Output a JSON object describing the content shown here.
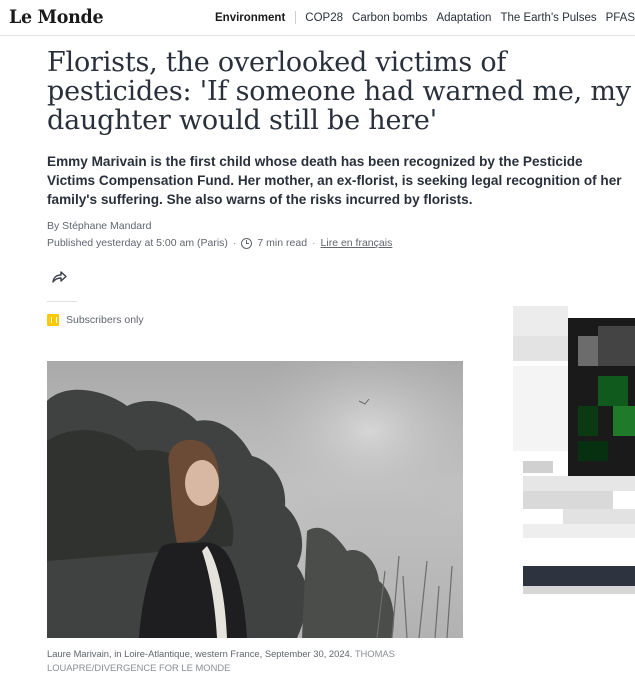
{
  "brand": {
    "logo_text": "Le Monde"
  },
  "nav": {
    "section": "Environment",
    "items": [
      "COP28",
      "Carbon bombs",
      "Adaptation",
      "The Earth's Pulses",
      "PFAS"
    ]
  },
  "article": {
    "headline": "Florists, the overlooked victims of pesticides: 'If someone had warned me, my daughter would still be here'",
    "standfirst": "Emmy Marivain is the first child whose death has been recognized by the Pesticide Victims Compensation Fund. Her mother, an ex-florist, is seeking legal recognition of her family's suffering. She also warns of the risks incurred by florists.",
    "byline": "By Stéphane Mandard",
    "published": "Published yesterday at 5:00 am (Paris)",
    "read_time": "7 min read",
    "french_link": "Lire en français",
    "subscribers_label": "Subscribers only",
    "caption": "Laure Marivain, in Loire-Atlantique, western France, September 30, 2024.",
    "credit": "THOMAS LOUAPRE/DIVERGENCE FOR LE MONDE"
  },
  "icons": {
    "share": "share-arrow-icon",
    "clock": "clock-icon",
    "subscriber": "subscriber-badge-icon"
  },
  "colors": {
    "text": "#2a303b",
    "muted": "#60656e",
    "subscriber_badge": "#ffc800"
  }
}
